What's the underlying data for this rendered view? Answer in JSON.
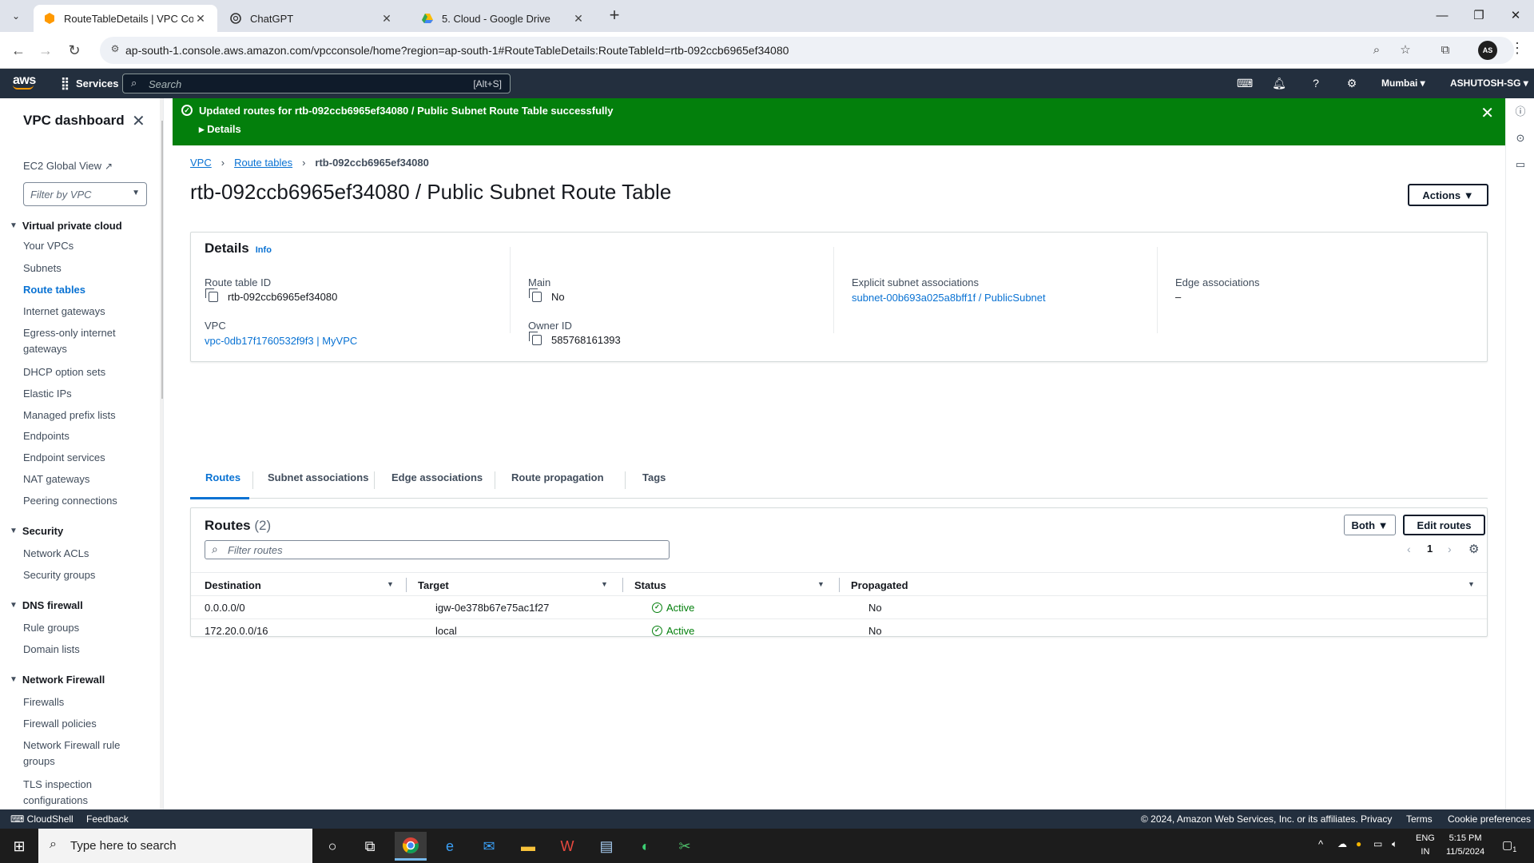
{
  "browser": {
    "tabs": [
      {
        "title": "RouteTableDetails | VPC Console",
        "active": true,
        "favicon": "aws-vpc-icon"
      },
      {
        "title": "ChatGPT",
        "active": false,
        "favicon": "chatgpt-icon"
      },
      {
        "title": "5. Cloud - Google Drive",
        "active": false,
        "favicon": "google-drive-icon"
      }
    ],
    "url": "ap-south-1.console.aws.amazon.com/vpcconsole/home?region=ap-south-1#RouteTableDetails:RouteTableId=rtb-092ccb6965ef34080",
    "profile_initials": "AS"
  },
  "aws_nav": {
    "logo": "aws",
    "services": "Services",
    "search_placeholder": "Search",
    "search_shortcut": "[Alt+S]",
    "region": "Mumbai",
    "account": "ASHUTOSH-SG"
  },
  "sidebar": {
    "title": "VPC dashboard",
    "ec2_global_view": "EC2 Global View",
    "filter_placeholder": "Filter by VPC",
    "sections": {
      "vpc": "Virtual private cloud",
      "security": "Security",
      "dns": "DNS firewall",
      "nfw": "Network Firewall"
    },
    "items": {
      "your_vpcs": "Your VPCs",
      "subnets": "Subnets",
      "route_tables": "Route tables",
      "igw": "Internet gateways",
      "egress_igw": "Egress-only internet gateways",
      "dhcp": "DHCP option sets",
      "eips": "Elastic IPs",
      "prefix_lists": "Managed prefix lists",
      "endpoints": "Endpoints",
      "endpoint_services": "Endpoint services",
      "nat": "NAT gateways",
      "peering": "Peering connections",
      "nacls": "Network ACLs",
      "sgs": "Security groups",
      "rule_groups": "Rule groups",
      "domain_lists": "Domain lists",
      "firewalls": "Firewalls",
      "fw_policies": "Firewall policies",
      "nfw_rule_groups": "Network Firewall rule groups",
      "tls": "TLS inspection configurations"
    }
  },
  "flash": {
    "message": "Updated routes for rtb-092ccb6965ef34080 / Public Subnet Route Table successfully",
    "details": "Details",
    "color": "#037f0c"
  },
  "breadcrumb": {
    "vpc": "VPC",
    "route_tables": "Route tables",
    "current": "rtb-092ccb6965ef34080"
  },
  "page": {
    "title": "rtb-092ccb6965ef34080 / Public Subnet Route Table",
    "actions": "Actions"
  },
  "details": {
    "heading": "Details",
    "info": "Info",
    "route_table_id_label": "Route table ID",
    "route_table_id": "rtb-092ccb6965ef34080",
    "main_label": "Main",
    "main": "No",
    "explicit_label": "Explicit subnet associations",
    "explicit": "subnet-00b693a025a8bff1f / PublicSubnet",
    "edge_label": "Edge associations",
    "edge": "–",
    "vpc_label": "VPC",
    "vpc": "vpc-0db17f1760532f9f3 | MyVPC",
    "owner_label": "Owner ID",
    "owner": "585768161393"
  },
  "tabs": [
    "Routes",
    "Subnet associations",
    "Edge associations",
    "Route propagation",
    "Tags"
  ],
  "routes": {
    "heading": "Routes",
    "count": "(2)",
    "filter_placeholder": "Filter routes",
    "both": "Both",
    "edit": "Edit routes",
    "page": "1",
    "columns": [
      "Destination",
      "Target",
      "Status",
      "Propagated"
    ],
    "rows": [
      {
        "destination": "0.0.0.0/0",
        "target": "igw-0e378b67e75ac1f27",
        "status": "Active",
        "propagated": "No"
      },
      {
        "destination": "172.20.0.0/16",
        "target": "local",
        "status": "Active",
        "propagated": "No"
      }
    ]
  },
  "footer": {
    "cloudshell": "CloudShell",
    "feedback": "Feedback",
    "copyright": "© 2024, Amazon Web Services, Inc. or its affiliates.",
    "privacy": "Privacy",
    "terms": "Terms",
    "cookies": "Cookie preferences"
  },
  "taskbar": {
    "search_placeholder": "Type here to search",
    "lang_top": "ENG",
    "lang_bottom": "IN",
    "time": "5:15 PM",
    "date": "11/5/2024",
    "notification_count": "1"
  }
}
